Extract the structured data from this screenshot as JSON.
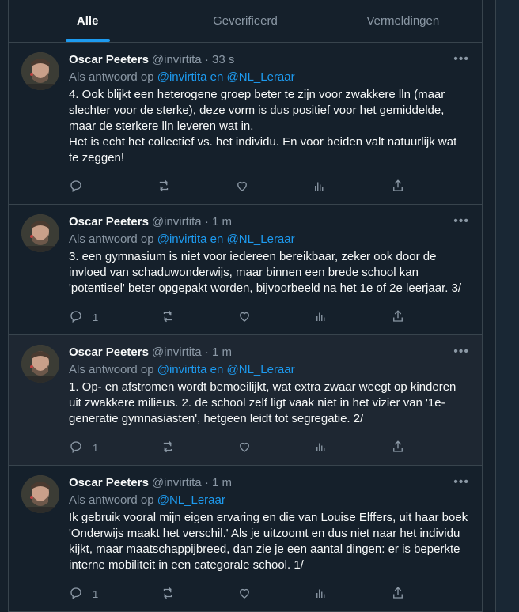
{
  "tabs": [
    {
      "label": "Alle"
    },
    {
      "label": "Geverifieerd"
    },
    {
      "label": "Vermeldingen"
    }
  ],
  "colors": {
    "accent": "#1d9bf0",
    "background": "#15202b",
    "highlight": "#1e2732"
  },
  "tweets": [
    {
      "name": "Oscar Peeters",
      "meta": "@invirtita · 33 s",
      "reply_prefix": "Als antwoord op",
      "reply_to": "@invirtita en @NL_Leraar",
      "text": "4. Ook blijkt een heterogene groep beter te zijn voor zwakkere lln (maar slechter voor de sterke), deze vorm is dus positief voor het gemiddelde, maar de sterkere lln leveren wat in.\nHet is echt het collectief vs. het individu. En voor beiden valt natuurlijk wat te zeggen!",
      "reply_count": "",
      "highlight": false
    },
    {
      "name": "Oscar Peeters",
      "meta": "@invirtita · 1 m",
      "reply_prefix": "Als antwoord op",
      "reply_to": "@invirtita en @NL_Leraar",
      "text": "3. een gymnasium is niet voor iedereen bereikbaar, zeker ook door de invloed van schaduwonderwijs, maar binnen een brede school kan 'potentieel' beter opgepakt worden, bijvoorbeeld na het 1e of 2e leerjaar. 3/",
      "reply_count": "1",
      "highlight": false
    },
    {
      "name": "Oscar Peeters",
      "meta": "@invirtita · 1 m",
      "reply_prefix": "Als antwoord op",
      "reply_to": "@invirtita en @NL_Leraar",
      "text": "1. Op- en afstromen wordt bemoeilijkt, wat extra zwaar weegt op kinderen uit zwakkere milieus. 2. de school zelf ligt vaak niet in het vizier van '1e-generatie gymnasiasten', hetgeen leidt tot segregatie. 2/",
      "reply_count": "1",
      "highlight": true
    },
    {
      "name": "Oscar Peeters",
      "meta": "@invirtita · 1 m",
      "reply_prefix": "Als antwoord op",
      "reply_to": "@NL_Leraar",
      "text": "Ik gebruik vooral mijn eigen ervaring en die van Louise Elffers, uit haar boek 'Onderwijs maakt het verschil.' Als je uitzoomt en dus niet naar het individu kijkt, maar maatschappijbreed, dan zie je een aantal dingen: er is beperkte interne mobiliteit in een categorale school. 1/",
      "reply_count": "1",
      "highlight": false
    }
  ]
}
